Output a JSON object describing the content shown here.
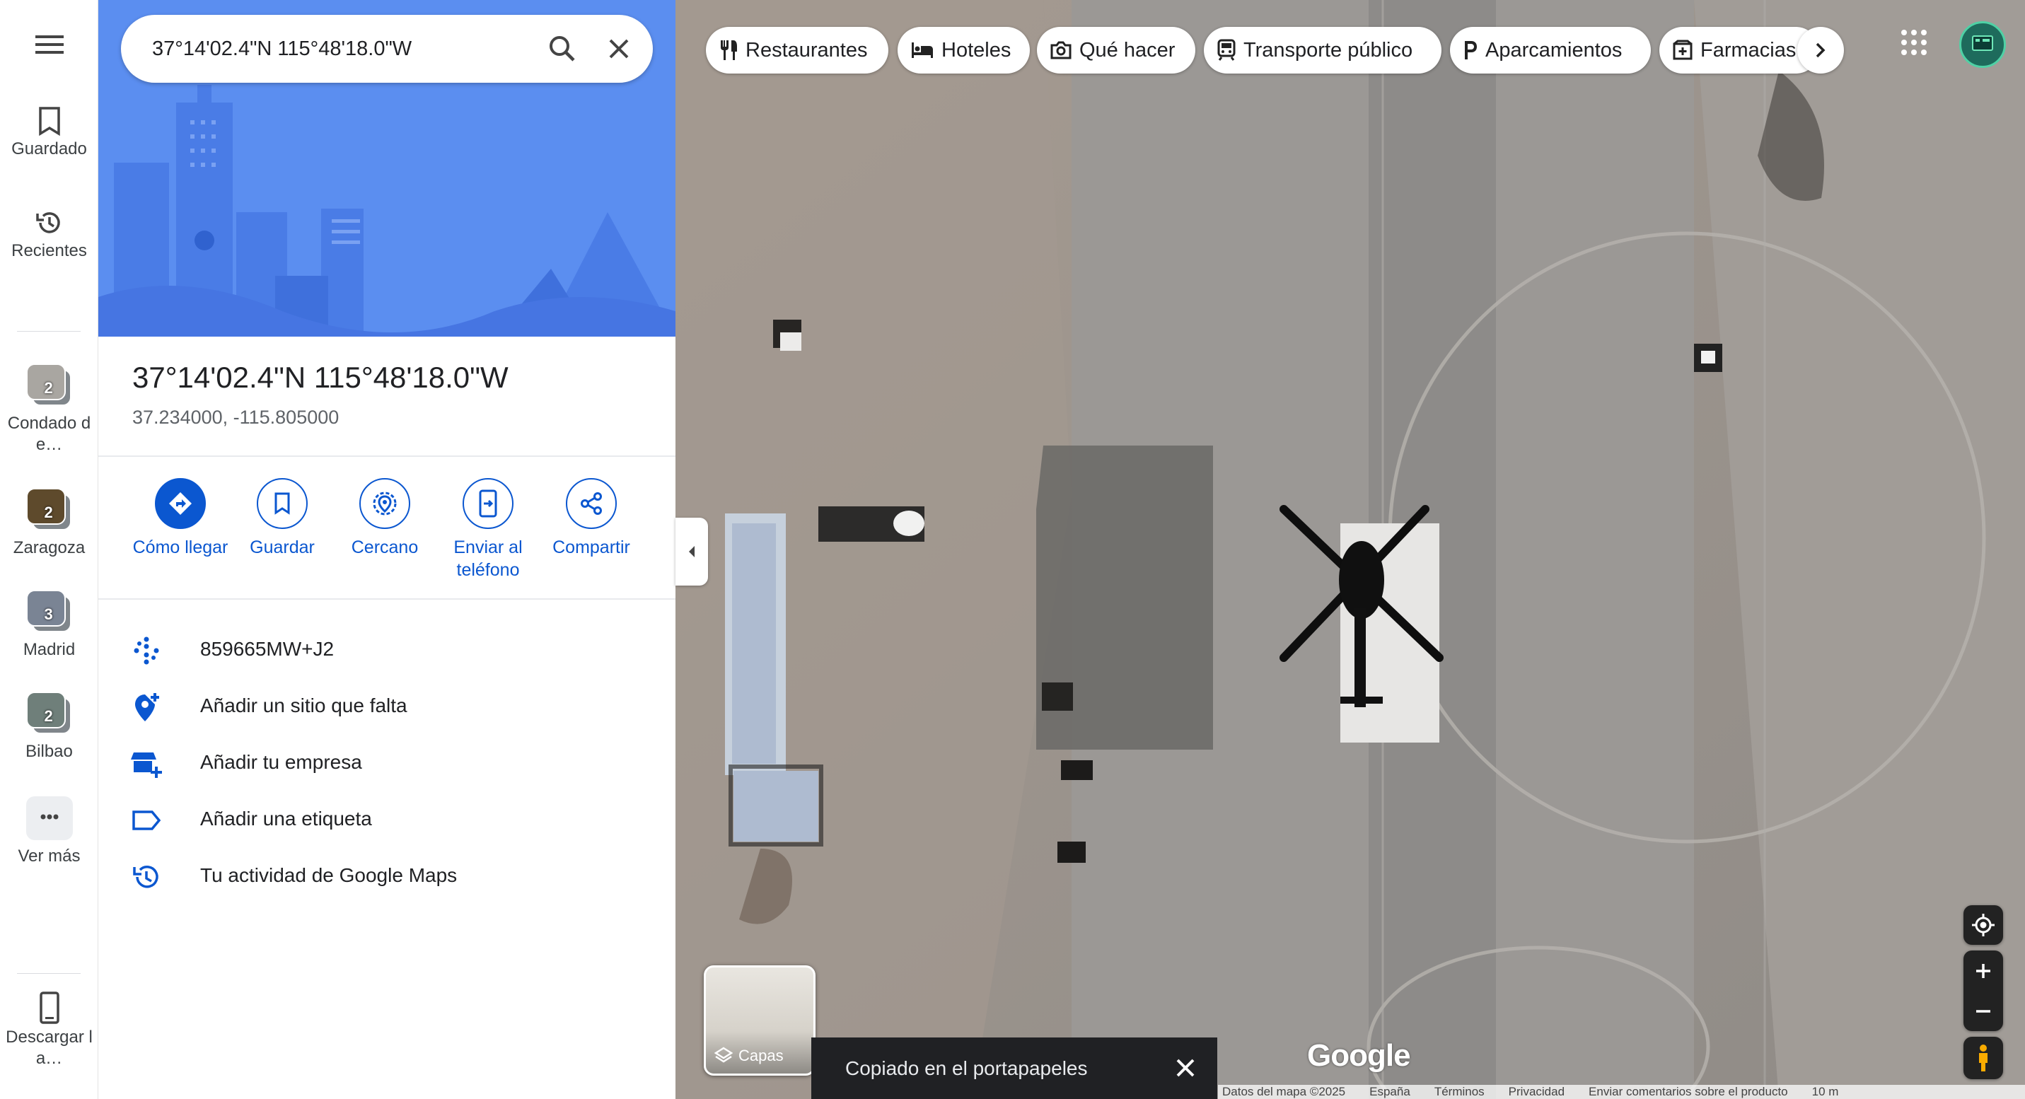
{
  "rail": {
    "menu_icon": "hamburger-icon",
    "saved": "Guardado",
    "recent": "Recientes",
    "recents": [
      {
        "label": "Condado de…",
        "count": "2",
        "color": "#a9a6a1"
      },
      {
        "label": "Zaragoza",
        "count": "2",
        "color": "#5e4a2c"
      },
      {
        "label": "Madrid",
        "count": "3",
        "color": "#7a8494"
      },
      {
        "label": "Bilbao",
        "count": "2",
        "color": "#6f7f7a"
      }
    ],
    "more": "Ver más",
    "download": "Descargar la…"
  },
  "search": {
    "value": "37°14'02.4\"N 115°48'18.0\"W"
  },
  "place": {
    "title": "37°14'02.4\"N 115°48'18.0\"W",
    "coords": "37.234000, -115.805000"
  },
  "actions": {
    "directions": "Cómo llegar",
    "save": "Guardar",
    "nearby": "Cercano",
    "send": "Enviar al teléfono",
    "share": "Compartir"
  },
  "info": {
    "plus_code": "859665MW+J2",
    "add_place": "Añadir un sitio que falta",
    "add_business": "Añadir tu empresa",
    "add_label": "Añadir una etiqueta",
    "activity": "Tu actividad de Google Maps"
  },
  "categories": {
    "restaurants": "Restaurantes",
    "hotels": "Hoteles",
    "things": "Qué hacer",
    "transit": "Transporte público",
    "parking": "Aparcamientos",
    "pharmacies": "Farmacias"
  },
  "map": {
    "layers": "Capas",
    "toast": "Copiado en el portapapeles",
    "logo": "Google",
    "footer": {
      "data": "Datos del mapa ©2025",
      "country": "España",
      "terms": "Términos",
      "privacy": "Privacidad",
      "feedback": "Enviar comentarios sobre el producto",
      "scale": "10 m"
    }
  },
  "colors": {
    "accent": "#0b57d0",
    "hero": "#5b8ef0",
    "toast_bg": "#202124"
  }
}
